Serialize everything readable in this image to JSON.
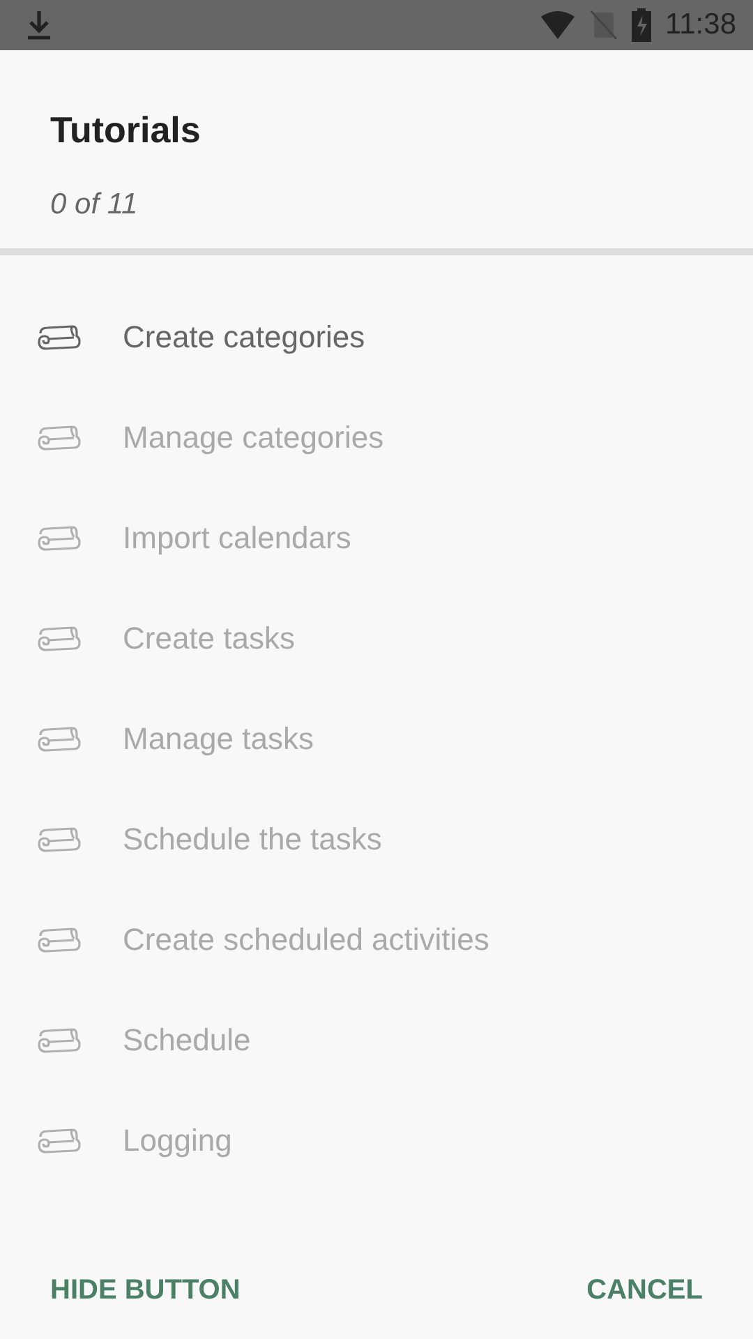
{
  "status_bar": {
    "time": "11:38"
  },
  "dialog": {
    "title": "Tutorials",
    "subtitle": "0 of 11"
  },
  "items": [
    {
      "label": "Create categories",
      "disabled": false
    },
    {
      "label": "Manage categories",
      "disabled": true
    },
    {
      "label": "Import calendars",
      "disabled": true
    },
    {
      "label": "Create tasks",
      "disabled": true
    },
    {
      "label": "Manage tasks",
      "disabled": true
    },
    {
      "label": "Schedule the tasks",
      "disabled": true
    },
    {
      "label": "Create scheduled activities",
      "disabled": true
    },
    {
      "label": "Schedule",
      "disabled": true
    },
    {
      "label": "Logging",
      "disabled": true
    }
  ],
  "buttons": [
    "HIDE BUTTON",
    "CANCEL"
  ]
}
